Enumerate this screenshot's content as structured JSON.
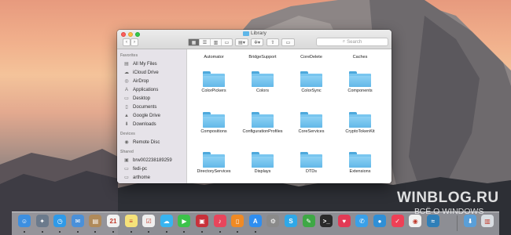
{
  "finder": {
    "title": "Library",
    "search_placeholder": "Search",
    "sidebar": {
      "favorites_header": "Favorites",
      "favorites": [
        {
          "label": "All My Files",
          "icon": "all-files-icon"
        },
        {
          "label": "iCloud Drive",
          "icon": "cloud-icon"
        },
        {
          "label": "AirDrop",
          "icon": "airdrop-icon"
        },
        {
          "label": "Applications",
          "icon": "applications-icon"
        },
        {
          "label": "Desktop",
          "icon": "desktop-icon"
        },
        {
          "label": "Documents",
          "icon": "documents-icon"
        },
        {
          "label": "Google Drive",
          "icon": "google-drive-icon"
        },
        {
          "label": "Downloads",
          "icon": "downloads-icon"
        }
      ],
      "devices_header": "Devices",
      "devices": [
        {
          "label": "Remote Disc",
          "icon": "disc-icon"
        }
      ],
      "shared_header": "Shared",
      "shared": [
        {
          "label": "brw002238189259",
          "icon": "printer-icon"
        },
        {
          "label": "fedi-pc",
          "icon": "computer-icon"
        },
        {
          "label": "arthome",
          "icon": "computer-icon"
        }
      ]
    },
    "top_row": [
      "Automator",
      "BridgeSupport",
      "CoreDelete",
      "Caches"
    ],
    "folders": [
      "ColorPickers",
      "Colors",
      "ColorSync",
      "Components",
      "Compositions",
      "ConfigurationProfiles",
      "CoreServices",
      "CryptoTokenKit",
      "DirectoryServices",
      "Displays",
      "DTDs",
      "Extensions"
    ],
    "colors": {
      "folder": "#62b8e8",
      "selection": "#6c6c6c"
    }
  },
  "watermark": {
    "line1": "WINBLOG.RU",
    "line2": "ВСЁ О WINDOWS"
  },
  "dock": {
    "apps": [
      {
        "name": "finder-icon",
        "color": "#3d8fe0"
      },
      {
        "name": "launchpad-icon",
        "color": "#6b7a8c"
      },
      {
        "name": "safari-icon",
        "color": "#2f9ae8"
      },
      {
        "name": "mail-icon",
        "color": "#4a90d9"
      },
      {
        "name": "contacts-icon",
        "color": "#b08a5a"
      },
      {
        "name": "calendar-icon",
        "color": "#f2f2f2"
      },
      {
        "name": "notes-icon",
        "color": "#f5e27a"
      },
      {
        "name": "reminders-icon",
        "color": "#efefef"
      },
      {
        "name": "messages-icon",
        "color": "#38b4f0"
      },
      {
        "name": "facetime-icon",
        "color": "#3cc24a"
      },
      {
        "name": "photo-booth-icon",
        "color": "#c8303a"
      },
      {
        "name": "itunes-icon",
        "color": "#e8455c"
      },
      {
        "name": "ibooks-icon",
        "color": "#f08a24"
      },
      {
        "name": "app-store-icon",
        "color": "#2f8ef0"
      },
      {
        "name": "system-preferences-icon",
        "color": "#8a8a8a"
      },
      {
        "name": "skype-icon",
        "color": "#2fa8e8"
      },
      {
        "name": "evernote-icon",
        "color": "#3ea845"
      },
      {
        "name": "terminal-icon",
        "color": "#2a2a2a"
      },
      {
        "name": "lips-icon",
        "color": "#e23a55"
      },
      {
        "name": "twitter-icon",
        "color": "#3aa0e8"
      },
      {
        "name": "tweetbot-icon",
        "color": "#2f8fd6"
      },
      {
        "name": "pocket-icon",
        "color": "#ee4056"
      },
      {
        "name": "chrome-icon",
        "color": "#f2f2f2"
      },
      {
        "name": "mavericks-icon",
        "color": "#2f7fb8"
      },
      {
        "name": "downloads-stack-icon",
        "color": "#5a9fd8"
      },
      {
        "name": "trash-icon",
        "color": "#d8dde2"
      }
    ]
  }
}
